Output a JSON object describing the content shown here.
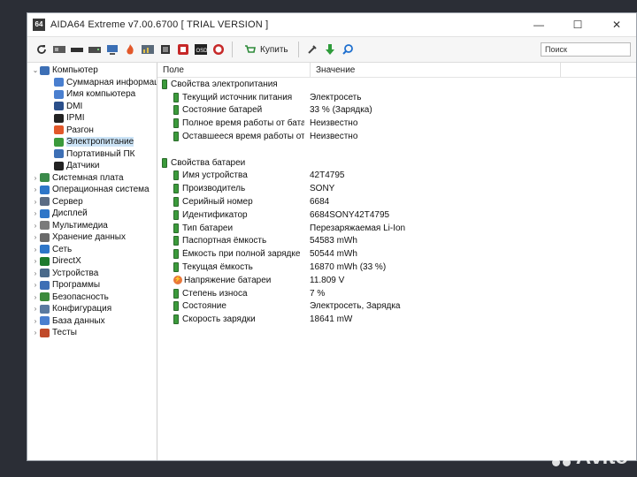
{
  "window": {
    "app_icon": "64",
    "title": "AIDA64 Extreme v7.00.6700  [ TRIAL VERSION ]",
    "minimize": "—",
    "maximize": "☐",
    "close": "✕"
  },
  "toolbar": {
    "buy_label": "Купить",
    "search_placeholder": "Поиск"
  },
  "tree": [
    {
      "label": "Компьютер",
      "level": 0,
      "expanded": true,
      "icon_color": "#3d6fb5"
    },
    {
      "label": "Суммарная информац",
      "level": 1,
      "icon_color": "#4a7fcf"
    },
    {
      "label": "Имя компьютера",
      "level": 1,
      "icon_color": "#4a7fcf"
    },
    {
      "label": "DMI",
      "level": 1,
      "icon_color": "#2b4f8a"
    },
    {
      "label": "IPMI",
      "level": 1,
      "icon_color": "#222222"
    },
    {
      "label": "Разгон",
      "level": 1,
      "icon_color": "#e2582a"
    },
    {
      "label": "Электропитание",
      "level": 1,
      "selected": true,
      "icon_color": "#3b9a3b"
    },
    {
      "label": "Портативный ПК",
      "level": 1,
      "icon_color": "#3d6fb5"
    },
    {
      "label": "Датчики",
      "level": 1,
      "icon_color": "#222222"
    },
    {
      "label": "Системная плата",
      "level": 0,
      "icon_color": "#3b8a4a"
    },
    {
      "label": "Операционная система",
      "level": 0,
      "icon_color": "#2e76c8"
    },
    {
      "label": "Сервер",
      "level": 0,
      "icon_color": "#5b6c84"
    },
    {
      "label": "Дисплей",
      "level": 0,
      "icon_color": "#2e76c8"
    },
    {
      "label": "Мультимедиа",
      "level": 0,
      "icon_color": "#7a7a7a"
    },
    {
      "label": "Хранение данных",
      "level": 0,
      "icon_color": "#6a6a6a"
    },
    {
      "label": "Сеть",
      "level": 0,
      "icon_color": "#2e76c8"
    },
    {
      "label": "DirectX",
      "level": 0,
      "icon_color": "#1d7a2e"
    },
    {
      "label": "Устройства",
      "level": 0,
      "icon_color": "#4a6a8a"
    },
    {
      "label": "Программы",
      "level": 0,
      "icon_color": "#3d6fb5"
    },
    {
      "label": "Безопасность",
      "level": 0,
      "icon_color": "#3b8a3b"
    },
    {
      "label": "Конфигурация",
      "level": 0,
      "icon_color": "#5a7aa0"
    },
    {
      "label": "База данных",
      "level": 0,
      "icon_color": "#4a7fcf"
    },
    {
      "label": "Тесты",
      "level": 0,
      "icon_color": "#c04a2a"
    }
  ],
  "columns": {
    "field": "Поле",
    "value": "Значение"
  },
  "power_group": {
    "title": "Свойства электропитания",
    "rows": [
      {
        "field": "Текущий источник питания",
        "value": "Электросеть"
      },
      {
        "field": "Состояние батарей",
        "value": "33 % (Зарядка)"
      },
      {
        "field": "Полное время работы от бата...",
        "value": "Неизвестно"
      },
      {
        "field": "Оставшееся время работы от ...",
        "value": "Неизвестно"
      }
    ]
  },
  "battery_group": {
    "title": "Свойства батареи",
    "rows": [
      {
        "field": "Имя устройства",
        "value": "42T4795"
      },
      {
        "field": "Производитель",
        "value": "SONY"
      },
      {
        "field": "Серийный номер",
        "value": "6684"
      },
      {
        "field": "Идентификатор",
        "value": "6684SONY42T4795"
      },
      {
        "field": "Тип батареи",
        "value": "Перезаряжаемая Li-Ion"
      },
      {
        "field": "Паспортная ёмкость",
        "value": "54583 mWh"
      },
      {
        "field": "Ёмкость при полной зарядке",
        "value": "50544 mWh"
      },
      {
        "field": "Текущая ёмкость",
        "value": "16870 mWh  (33 %)"
      },
      {
        "field": "Напряжение батареи",
        "value": "11.809 V",
        "icon": "bolt"
      },
      {
        "field": "Степень износа",
        "value": "7 %"
      },
      {
        "field": "Состояние",
        "value": "Электросеть, Зарядка"
      },
      {
        "field": "Скорость зарядки",
        "value": "18641 mW"
      }
    ]
  },
  "watermark": "Avito"
}
